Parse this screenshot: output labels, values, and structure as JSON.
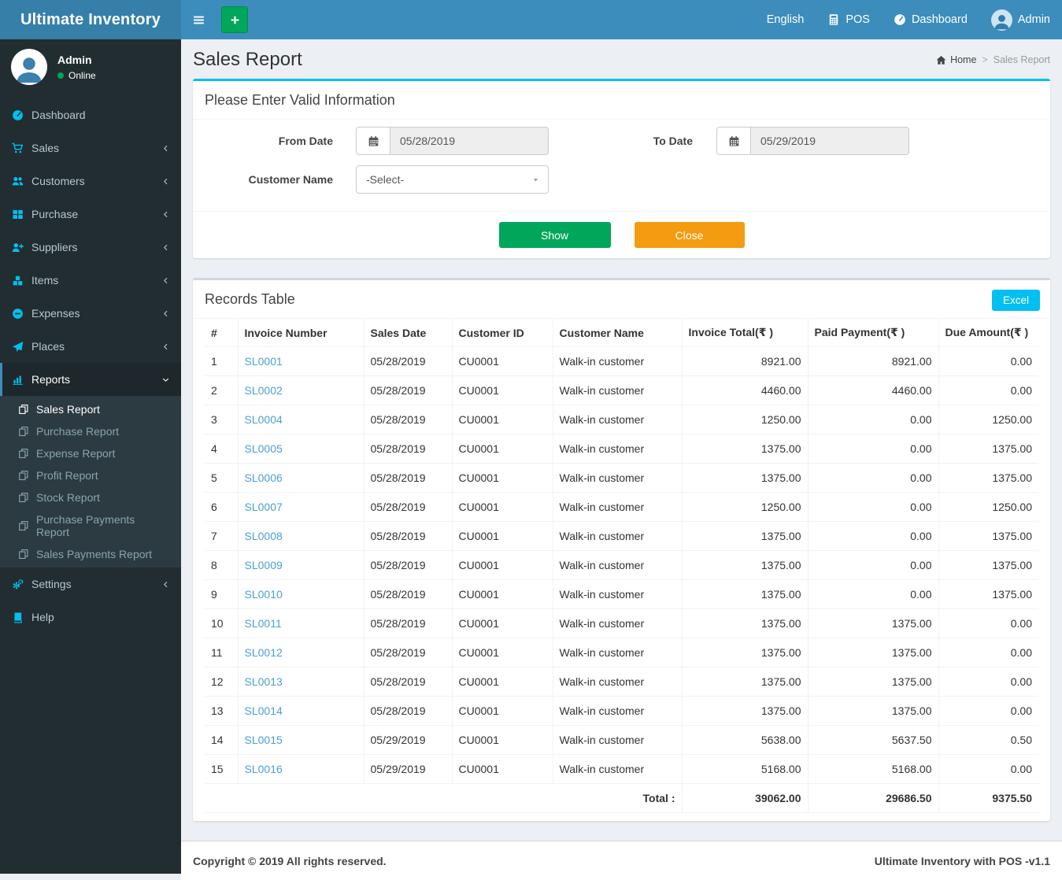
{
  "colors": {
    "navbar": "#3c8dbc",
    "logo_bg": "#367fa9",
    "sidebar_bg": "#222d32",
    "submenu_bg": "#2c3b41",
    "sidebar_icon": "#00c0ef",
    "active_border": "#3c8dbc",
    "content_bg": "#ecf0f5",
    "panel_top_info": "#00c0ef",
    "panel_top_default": "#d2d6de",
    "show_button": "#00a65a",
    "close_button": "#f39c12",
    "excel_button": "#00c0ef",
    "add_button": "#00a65a",
    "link": "#4b9fd4",
    "online_dot": "#00a65a"
  },
  "navbar": {
    "brand": "Ultimate Inventory",
    "language": "English",
    "pos": "POS",
    "dashboard": "Dashboard",
    "user": "Admin"
  },
  "sidebar": {
    "user": {
      "name": "Admin",
      "status": "Online"
    },
    "menu": [
      {
        "label": "Dashboard",
        "icon": "dashboard-icon"
      },
      {
        "label": "Sales",
        "icon": "cart-icon",
        "chevron": "left"
      },
      {
        "label": "Customers",
        "icon": "users-icon",
        "chevron": "left"
      },
      {
        "label": "Purchase",
        "icon": "grid-icon",
        "chevron": "left"
      },
      {
        "label": "Suppliers",
        "icon": "user-plus-icon",
        "chevron": "left"
      },
      {
        "label": "Items",
        "icon": "cubes-icon",
        "chevron": "left"
      },
      {
        "label": "Expenses",
        "icon": "minus-circle-icon",
        "chevron": "left"
      },
      {
        "label": "Places",
        "icon": "paper-plane-icon",
        "chevron": "left"
      },
      {
        "label": "Reports",
        "icon": "bar-chart-icon",
        "chevron": "down",
        "active": true,
        "submenu": [
          {
            "label": "Sales Report",
            "icon": "copy-icon",
            "active": true
          },
          {
            "label": "Purchase Report",
            "icon": "copy-icon"
          },
          {
            "label": "Expense Report",
            "icon": "copy-icon"
          },
          {
            "label": "Profit Report",
            "icon": "copy-icon"
          },
          {
            "label": "Stock Report",
            "icon": "copy-icon"
          },
          {
            "label": "Purchase Payments Report",
            "icon": "copy-icon"
          },
          {
            "label": "Sales Payments Report",
            "icon": "copy-icon"
          }
        ]
      },
      {
        "label": "Settings",
        "icon": "gears-icon",
        "chevron": "left"
      },
      {
        "label": "Help",
        "icon": "book-icon"
      }
    ]
  },
  "page": {
    "title": "Sales Report",
    "breadcrumb": {
      "home": "Home",
      "separator": ">",
      "current": "Sales Report"
    }
  },
  "filter": {
    "title": "Please Enter Valid Information",
    "from_date": {
      "label": "From Date",
      "value": "05/28/2019"
    },
    "to_date": {
      "label": "To Date",
      "value": "05/29/2019"
    },
    "customer": {
      "label": "Customer Name",
      "value": "-Select-"
    },
    "show_label": "Show",
    "close_label": "Close"
  },
  "records": {
    "title": "Records Table",
    "excel_label": "Excel",
    "columns": [
      "#",
      "Invoice Number",
      "Sales Date",
      "Customer ID",
      "Customer Name",
      "Invoice Total(₹ )",
      "Paid Payment(₹ )",
      "Due Amount(₹ )"
    ],
    "rows": [
      [
        "1",
        "SL0001",
        "05/28/2019",
        "CU0001",
        "Walk-in customer",
        "8921.00",
        "8921.00",
        "0.00"
      ],
      [
        "2",
        "SL0002",
        "05/28/2019",
        "CU0001",
        "Walk-in customer",
        "4460.00",
        "4460.00",
        "0.00"
      ],
      [
        "3",
        "SL0004",
        "05/28/2019",
        "CU0001",
        "Walk-in customer",
        "1250.00",
        "0.00",
        "1250.00"
      ],
      [
        "4",
        "SL0005",
        "05/28/2019",
        "CU0001",
        "Walk-in customer",
        "1375.00",
        "0.00",
        "1375.00"
      ],
      [
        "5",
        "SL0006",
        "05/28/2019",
        "CU0001",
        "Walk-in customer",
        "1375.00",
        "0.00",
        "1375.00"
      ],
      [
        "6",
        "SL0007",
        "05/28/2019",
        "CU0001",
        "Walk-in customer",
        "1250.00",
        "0.00",
        "1250.00"
      ],
      [
        "7",
        "SL0008",
        "05/28/2019",
        "CU0001",
        "Walk-in customer",
        "1375.00",
        "0.00",
        "1375.00"
      ],
      [
        "8",
        "SL0009",
        "05/28/2019",
        "CU0001",
        "Walk-in customer",
        "1375.00",
        "0.00",
        "1375.00"
      ],
      [
        "9",
        "SL0010",
        "05/28/2019",
        "CU0001",
        "Walk-in customer",
        "1375.00",
        "0.00",
        "1375.00"
      ],
      [
        "10",
        "SL0011",
        "05/28/2019",
        "CU0001",
        "Walk-in customer",
        "1375.00",
        "1375.00",
        "0.00"
      ],
      [
        "11",
        "SL0012",
        "05/28/2019",
        "CU0001",
        "Walk-in customer",
        "1375.00",
        "1375.00",
        "0.00"
      ],
      [
        "12",
        "SL0013",
        "05/28/2019",
        "CU0001",
        "Walk-in customer",
        "1375.00",
        "1375.00",
        "0.00"
      ],
      [
        "13",
        "SL0014",
        "05/28/2019",
        "CU0001",
        "Walk-in customer",
        "1375.00",
        "1375.00",
        "0.00"
      ],
      [
        "14",
        "SL0015",
        "05/29/2019",
        "CU0001",
        "Walk-in customer",
        "5638.00",
        "5637.50",
        "0.50"
      ],
      [
        "15",
        "SL0016",
        "05/29/2019",
        "CU0001",
        "Walk-in customer",
        "5168.00",
        "5168.00",
        "0.00"
      ]
    ],
    "total": {
      "label": "Total :",
      "invoice_total": "39062.00",
      "paid_payment": "29686.50",
      "due_amount": "9375.50"
    }
  },
  "footer": {
    "left": "Copyright © 2019 All rights reserved.",
    "right": "Ultimate Inventory with POS -v1.1"
  }
}
